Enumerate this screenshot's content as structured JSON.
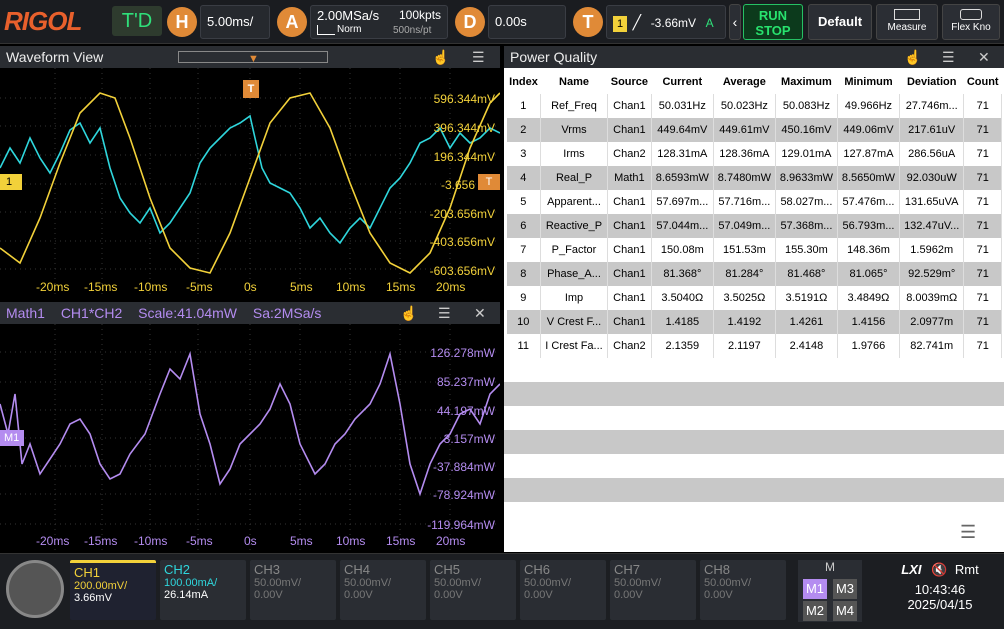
{
  "brand": "RIGOL",
  "trigger_mode": "T'D",
  "horizontal": {
    "icon_label": "H",
    "timebase": "5.00ms/"
  },
  "acquire": {
    "icon_label": "A",
    "sample_rate": "2.00MSa/s",
    "mode": "Norm",
    "points": "100kpts",
    "point_time": "500ns/pt"
  },
  "delay": {
    "icon_label": "D",
    "value": "0.00s"
  },
  "trigger": {
    "icon_label": "T",
    "source": "1",
    "level": "-3.66mV",
    "mode": "A"
  },
  "buttons": {
    "run": "RUN",
    "stop": "STOP",
    "default": "Default",
    "measure": "Measure",
    "flex": "Flex Kno"
  },
  "waveform_view": {
    "title": "Waveform View",
    "trigger_marker": "T",
    "ch1_marker": "1",
    "y_labels": [
      "596.344mV",
      "396.344mV",
      "196.344mV",
      "-3.656",
      "-203.656mV",
      "-403.656mV",
      "-603.656mV"
    ],
    "x_labels": [
      "-20ms",
      "-15ms",
      "-10ms",
      "-5ms",
      "0s",
      "5ms",
      "10ms",
      "15ms",
      "20ms"
    ]
  },
  "math_view": {
    "name": "Math1",
    "expr": "CH1*CH2",
    "scale": "Scale:41.04mW",
    "sample": "Sa:2MSa/s",
    "marker": "M1",
    "y_labels": [
      "126.278mW",
      "85.237mW",
      "44.197mW",
      "3.157mW",
      "-37.884mW",
      "-78.924mW",
      "-119.964mW"
    ],
    "x_labels": [
      "-20ms",
      "-15ms",
      "-10ms",
      "-5ms",
      "0s",
      "5ms",
      "10ms",
      "15ms",
      "20ms"
    ]
  },
  "power_quality": {
    "title": "Power Quality",
    "columns": [
      "Index",
      "Name",
      "Source",
      "Current",
      "Average",
      "Maximum",
      "Minimum",
      "Deviation",
      "Count"
    ],
    "rows": [
      [
        "1",
        "Ref_Freq",
        "Chan1",
        "50.031Hz",
        "50.023Hz",
        "50.083Hz",
        "49.966Hz",
        "27.746m...",
        "71"
      ],
      [
        "2",
        "Vrms",
        "Chan1",
        "449.64mV",
        "449.61mV",
        "450.16mV",
        "449.06mV",
        "217.61uV",
        "71"
      ],
      [
        "3",
        "Irms",
        "Chan2",
        "128.31mA",
        "128.36mA",
        "129.01mA",
        "127.87mA",
        "286.56uA",
        "71"
      ],
      [
        "4",
        "Real_P",
        "Math1",
        "8.6593mW",
        "8.7480mW",
        "8.9633mW",
        "8.5650mW",
        "92.030uW",
        "71"
      ],
      [
        "5",
        "Apparent...",
        "Chan1",
        "57.697m...",
        "57.716m...",
        "58.027m...",
        "57.476m...",
        "131.65uVA",
        "71"
      ],
      [
        "6",
        "Reactive_P",
        "Chan1",
        "57.044m...",
        "57.049m...",
        "57.368m...",
        "56.793m...",
        "132.47uV...",
        "71"
      ],
      [
        "7",
        "P_Factor",
        "Chan1",
        "150.08m",
        "151.53m",
        "155.30m",
        "148.36m",
        "1.5962m",
        "71"
      ],
      [
        "8",
        "Phase_A...",
        "Chan1",
        "81.368°",
        "81.284°",
        "81.468°",
        "81.065°",
        "92.529m°",
        "71"
      ],
      [
        "9",
        "Imp",
        "Chan1",
        "3.5040Ω",
        "3.5025Ω",
        "3.5191Ω",
        "3.4849Ω",
        "8.0039mΩ",
        "71"
      ],
      [
        "10",
        "V Crest F...",
        "Chan1",
        "1.4185",
        "1.4192",
        "1.4261",
        "1.4156",
        "2.0977m",
        "71"
      ],
      [
        "11",
        "I Crest Fa...",
        "Chan2",
        "2.1359",
        "2.1197",
        "2.4148",
        "1.9766",
        "82.741m",
        "71"
      ]
    ]
  },
  "channels": [
    {
      "name": "CH1",
      "scale": "200.00mV/",
      "offset": "3.66mV",
      "color": "#f2d13a"
    },
    {
      "name": "CH2",
      "scale": "100.00mA/",
      "offset": "26.14mA",
      "color": "#2fd6dc"
    },
    {
      "name": "CH3",
      "scale": "50.00mV/",
      "offset": "0.00V",
      "color": "#888888"
    },
    {
      "name": "CH4",
      "scale": "50.00mV/",
      "offset": "0.00V",
      "color": "#888888"
    },
    {
      "name": "CH5",
      "scale": "50.00mV/",
      "offset": "0.00V",
      "color": "#888888"
    },
    {
      "name": "CH6",
      "scale": "50.00mV/",
      "offset": "0.00V",
      "color": "#888888"
    },
    {
      "name": "CH7",
      "scale": "50.00mV/",
      "offset": "0.00V",
      "color": "#888888"
    },
    {
      "name": "CH8",
      "scale": "50.00mV/",
      "offset": "0.00V",
      "color": "#888888"
    }
  ],
  "math_group": {
    "title": "M",
    "m1": "M1",
    "m2": "M2",
    "m3": "M3",
    "m4": "M4"
  },
  "status": {
    "lxi": "LXI",
    "rmt": "Rmt",
    "time": "10:43:46",
    "date": "2025/04/15"
  },
  "colors": {
    "ch1": "#f2d13a",
    "ch2": "#2fd6dc",
    "math": "#b48cf0",
    "accent": "#e08a37",
    "run": "#28e26e"
  }
}
